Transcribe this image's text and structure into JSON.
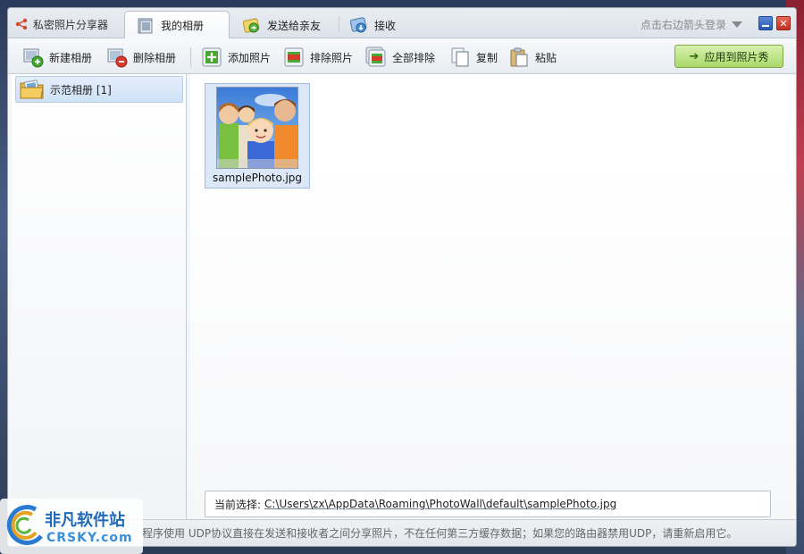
{
  "window": {
    "brand": "私密照片分享器",
    "login_hint": "点击右边箭头登录"
  },
  "tabs": [
    {
      "label": "我的相册",
      "active": true
    },
    {
      "label": "发送给亲友",
      "active": false
    },
    {
      "label": "接收",
      "active": false
    }
  ],
  "toolbar": {
    "new_album": "新建相册",
    "delete_album": "删除相册",
    "add_photo": "添加照片",
    "remove_photo": "排除照片",
    "remove_all": "全部排除",
    "copy": "复制",
    "paste": "粘贴",
    "apply": "应用到照片秀"
  },
  "albums": [
    {
      "label": "示范相册 [1]"
    }
  ],
  "photos": [
    {
      "filename": "samplePhoto.jpg"
    }
  ],
  "selection": {
    "label": "当前选择:",
    "path": "C:\\Users\\zx\\AppData\\Roaming\\PhotoWall\\default\\samplePhoto.jpg"
  },
  "status": {
    "text": "程序使用 UDP协议直接在发送和接收者之间分享照片，不在任何第三方缓存数据；如果您的路由器禁用UDP，请重新启用它。"
  },
  "watermark": {
    "title": "非凡软件站",
    "sub": "CRSKY.com"
  },
  "colors": {
    "accent": "#1e6ab8",
    "apply_green": "#a9d86a",
    "selection_blue": "#d0e2f7"
  }
}
